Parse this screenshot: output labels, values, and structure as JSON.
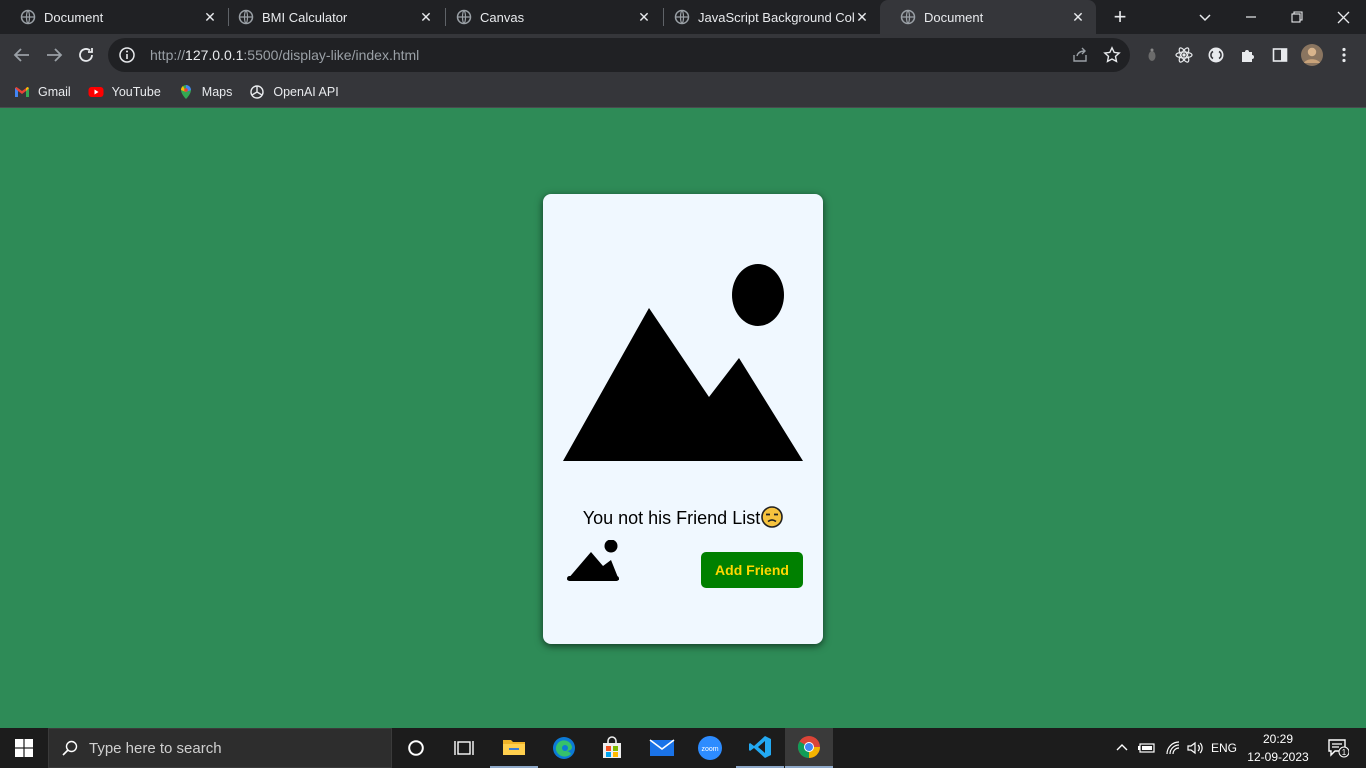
{
  "browser": {
    "tabs": [
      {
        "title": "Document",
        "active": false
      },
      {
        "title": "BMI Calculator",
        "active": false
      },
      {
        "title": "Canvas",
        "active": false
      },
      {
        "title": "JavaScript Background Color",
        "active": false
      },
      {
        "title": "Document",
        "active": true
      }
    ],
    "address": {
      "prefix": "http://",
      "host": "127.0.0.1",
      "rest": ":5500/display-like/index.html"
    },
    "bookmarks": [
      {
        "label": "Gmail",
        "icon": "gmail-icon"
      },
      {
        "label": "YouTube",
        "icon": "youtube-icon"
      },
      {
        "label": "Maps",
        "icon": "maps-icon"
      },
      {
        "label": "OpenAI API",
        "icon": "openai-icon"
      }
    ]
  },
  "page": {
    "background": "#2e8b57",
    "card": {
      "message": "You not his Friend List",
      "emoji": "unamused-face",
      "button_label": "Add Friend",
      "button_color": "#008000",
      "button_text_color": "#ffd700"
    }
  },
  "taskbar": {
    "search_placeholder": "Type here to search",
    "language": "ENG",
    "time": "20:29",
    "date": "12-09-2023",
    "notification_count": "1"
  }
}
